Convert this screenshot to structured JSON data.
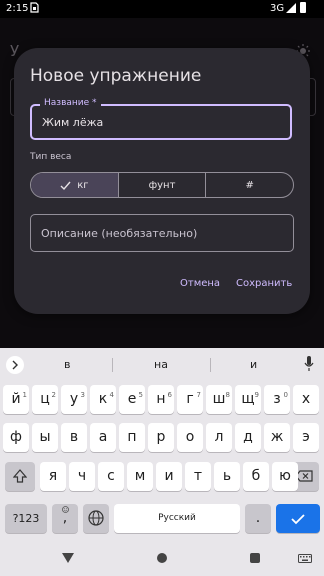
{
  "status": {
    "time": "2:15",
    "network": "3G"
  },
  "background": {
    "title_partial": "У"
  },
  "dialog": {
    "title": "Новое упражнение",
    "name_label": "Название *",
    "name_value": "Жим лёжа",
    "weight_type_label": "Тип веса",
    "weight_options": [
      "кг",
      "фунт",
      "#"
    ],
    "selected_weight": "кг",
    "description_placeholder": "Описание (необязательно)",
    "cancel_label": "Отмена",
    "save_label": "Сохранить",
    "accent": "#d0bcff"
  },
  "keyboard": {
    "suggestions": [
      "в",
      "на",
      "и"
    ],
    "row1": [
      "й",
      "ц",
      "у",
      "к",
      "е",
      "н",
      "г",
      "ш",
      "щ",
      "з",
      "х"
    ],
    "row1_sup": [
      "1",
      "2",
      "3",
      "4",
      "5",
      "6",
      "7",
      "8",
      "9",
      "0",
      ""
    ],
    "row2": [
      "ф",
      "ы",
      "в",
      "а",
      "п",
      "р",
      "о",
      "л",
      "д",
      "ж",
      "э"
    ],
    "row3": [
      "я",
      "ч",
      "с",
      "м",
      "и",
      "т",
      "ь",
      "б",
      "ю"
    ],
    "symbols_label": "?123",
    "emoji_key": ",",
    "space_label": "Русский",
    "period_key": ".",
    "enter_color": "#1a73e8"
  }
}
